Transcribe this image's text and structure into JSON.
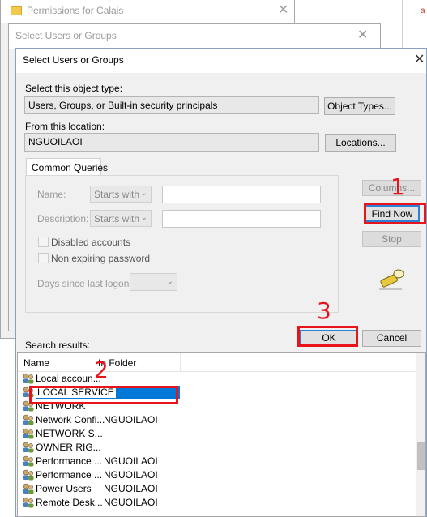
{
  "permissions_window": {
    "title": "Permissions for Calais"
  },
  "background_dialog": {
    "title": "Select Users or Groups"
  },
  "dialog": {
    "title": "Select Users or Groups",
    "object_type_label": "Select this object type:",
    "object_type_value": "Users, Groups, or Built-in security principals",
    "object_types_button": "Object Types...",
    "location_label": "From this location:",
    "location_value": "NGUOILAOI",
    "locations_button": "Locations...",
    "tab_common_queries": "Common Queries",
    "name_label": "Name:",
    "name_mode": "Starts with",
    "description_label": "Description:",
    "description_mode": "Starts with",
    "disabled_accounts_label": "Disabled accounts",
    "non_expiring_label": "Non expiring password",
    "days_since_logon_label": "Days since last logon:",
    "columns_button": "Columns...",
    "find_now_button": "Find Now",
    "stop_button": "Stop",
    "ok_button": "OK",
    "cancel_button": "Cancel",
    "search_results_label": "Search results:",
    "results_columns": {
      "name": "Name",
      "in_folder": "In Folder"
    },
    "results": [
      {
        "name": "Local accoun...",
        "folder": ""
      },
      {
        "name": "LOCAL SERVICE",
        "folder": "",
        "selected": true
      },
      {
        "name": "NETWORK",
        "folder": ""
      },
      {
        "name": "Network Confi...",
        "folder": "NGUOILAOI"
      },
      {
        "name": "NETWORK S...",
        "folder": ""
      },
      {
        "name": "OWNER RIG...",
        "folder": ""
      },
      {
        "name": "Performance ...",
        "folder": "NGUOILAOI"
      },
      {
        "name": "Performance ...",
        "folder": "NGUOILAOI"
      },
      {
        "name": "Power Users",
        "folder": "NGUOILAOI"
      },
      {
        "name": "Remote Desk...",
        "folder": "NGUOILAOI"
      }
    ]
  },
  "annotations": {
    "step1": "1",
    "step2": "2",
    "step3": "3"
  },
  "colors": {
    "selection": "#0078d7",
    "annotation": "#e8141c"
  }
}
